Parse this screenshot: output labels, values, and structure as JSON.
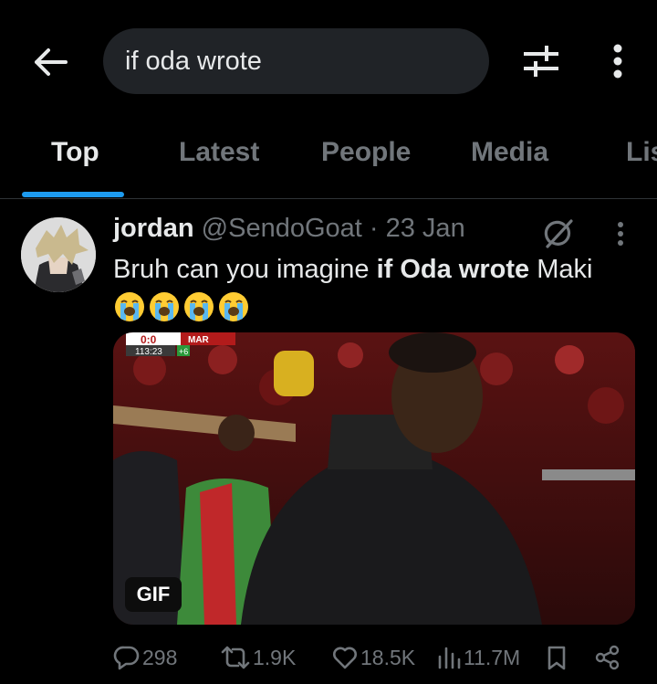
{
  "header": {
    "search_value": "if oda wrote",
    "back_icon": "arrow-left-icon",
    "filter_icon": "sliders-icon",
    "more_icon": "vertical-dots-icon"
  },
  "tabs": [
    {
      "label": "Top",
      "active": true
    },
    {
      "label": "Latest",
      "active": false
    },
    {
      "label": "People",
      "active": false
    },
    {
      "label": "Media",
      "active": false
    },
    {
      "label": "Lis",
      "active": false
    }
  ],
  "tweet": {
    "name": "jordan",
    "meta": " @SendoGoat · 23 Jan",
    "text_before": "Bruh can you imagine ",
    "text_bold": "if Oda wrote",
    "text_after": " Maki",
    "emoji_count": 4,
    "media_badge": "GIF",
    "scoreboard": {
      "score": "0:0",
      "team": "MAR",
      "time": "113:23",
      "extra": "+6"
    },
    "replies": "298",
    "reposts": "1.9K",
    "likes": "18.5K",
    "views": "11.7M"
  },
  "colors": {
    "background": "#000000",
    "text": "#e7e9ea",
    "muted": "#71767b",
    "accent": "#1d9bf0",
    "search_bg": "#202327"
  }
}
